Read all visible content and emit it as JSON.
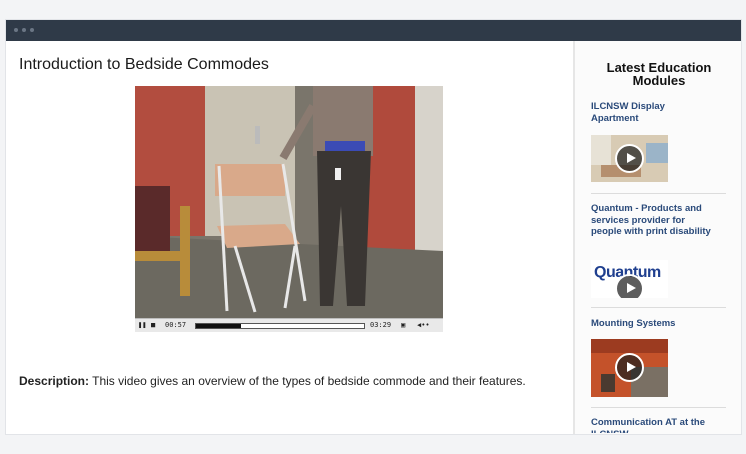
{
  "page": {
    "title": "Introduction to Bedside Commodes",
    "description_label": "Description:",
    "description_text": " This video gives an overview of the types of bedside commode and their features."
  },
  "player": {
    "elapsed": "00:57",
    "duration": "03:29",
    "progress_fraction": 0.27,
    "icons": [
      "pause-icon",
      "stop-icon",
      "fullscreen-icon",
      "volume-icon"
    ]
  },
  "sidebar": {
    "heading": "Latest Education Modules",
    "items": [
      {
        "title": "ILCNSW Display Apartment",
        "thumb": "apartment-room"
      },
      {
        "title": "Quantum - Products and services provider for people with print disability",
        "thumb": "quantum-logo",
        "logo_text": "Quantum"
      },
      {
        "title": "Mounting Systems",
        "thumb": "orange-room"
      },
      {
        "title": "Communication AT at the ILCNSW",
        "thumb": ""
      }
    ]
  },
  "colors": {
    "titlebar": "#2f3a48",
    "link": "#2a4a7a",
    "quantum_blue": "#1f3f8f"
  }
}
